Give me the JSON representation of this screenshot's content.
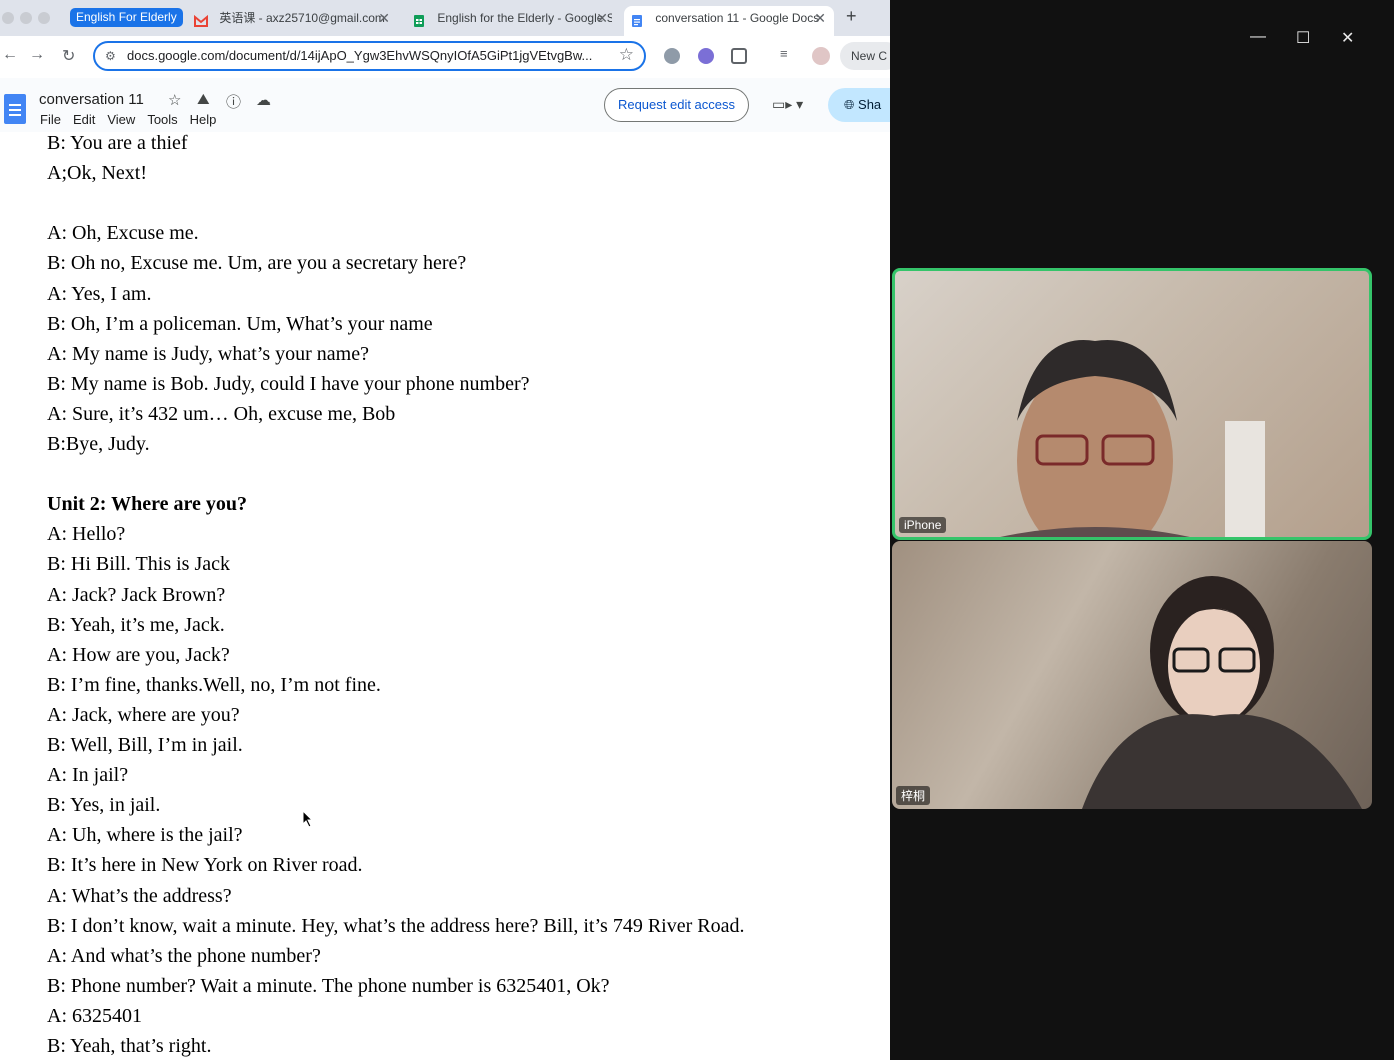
{
  "browser": {
    "tab_group_label": "English For Elderly",
    "tabs": [
      {
        "title": "英语课 - axz25710@gmail.com",
        "icon": "gmail-icon"
      },
      {
        "title": "English for the Elderly - Google Sheets",
        "icon": "sheets-icon"
      },
      {
        "title": "conversation 11 - Google Docs",
        "icon": "docs-icon",
        "active": true
      }
    ],
    "url": "docs.google.com/document/d/14ijApO_Ygw3EhvWSQnyIOfA5GiPt1jgVEtvgBw...",
    "new_chrome_label": "New C"
  },
  "doc": {
    "title": "conversation 11",
    "menus": [
      "File",
      "Edit",
      "View",
      "Tools",
      "Help"
    ],
    "request_edit_label": "Request edit access",
    "share_label": "Sha",
    "lines": [
      {
        "text": "B: You are a thief",
        "bold": false
      },
      {
        "text": "A;Ok, Next!",
        "bold": false
      },
      {
        "text": "",
        "bold": false
      },
      {
        "text": "A: Oh, Excuse me.",
        "bold": false
      },
      {
        "text": "B: Oh no, Excuse me. Um, are you a secretary here?",
        "bold": false
      },
      {
        "text": "A: Yes, I am.",
        "bold": false
      },
      {
        "text": "B: Oh, I’m a policeman. Um, What’s your name",
        "bold": false
      },
      {
        "text": "A: My name is Judy, what’s your name?",
        "bold": false
      },
      {
        "text": "B: My name is Bob. Judy, could I have your phone number?",
        "bold": false
      },
      {
        "text": "A: Sure, it’s 432 um… Oh, excuse me, Bob",
        "bold": false
      },
      {
        "text": "B:Bye, Judy.",
        "bold": false
      },
      {
        "text": "",
        "bold": false
      },
      {
        "text": "Unit 2: Where are you?",
        "bold": true
      },
      {
        "text": "A: Hello?",
        "bold": false
      },
      {
        "text": "B: Hi Bill. This is Jack",
        "bold": false
      },
      {
        "text": "A: Jack? Jack Brown?",
        "bold": false
      },
      {
        "text": "B: Yeah, it’s me, Jack.",
        "bold": false
      },
      {
        "text": "A: How are you, Jack?",
        "bold": false
      },
      {
        "text": "B: I’m fine, thanks.Well, no, I’m not fine.",
        "bold": false
      },
      {
        "text": "A: Jack, where are you?",
        "bold": false
      },
      {
        "text": "B: Well, Bill, I’m in jail.",
        "bold": false
      },
      {
        "text": "A: In jail?",
        "bold": false
      },
      {
        "text": "B: Yes, in jail.",
        "bold": false
      },
      {
        "text": "A: Uh, where is the jail?",
        "bold": false
      },
      {
        "text": "B: It’s here in New York on River road.",
        "bold": false
      },
      {
        "text": "A: What’s the address?",
        "bold": false
      },
      {
        "text": "B: I don’t know, wait a minute. Hey, what’s the address here? Bill, it’s 749 River Road.",
        "bold": false
      },
      {
        "text": "A: And what’s the phone number?",
        "bold": false
      },
      {
        "text": "B: Phone number? Wait a minute. The phone number is 6325401, Ok?",
        "bold": false
      },
      {
        "text": "A: 6325401",
        "bold": false
      },
      {
        "text": "B: Yeah, that’s right.",
        "bold": false
      }
    ]
  },
  "video": {
    "participants": [
      {
        "name": "iPhone",
        "active_speaker": true
      },
      {
        "name": "梓桐",
        "active_speaker": false
      }
    ]
  }
}
